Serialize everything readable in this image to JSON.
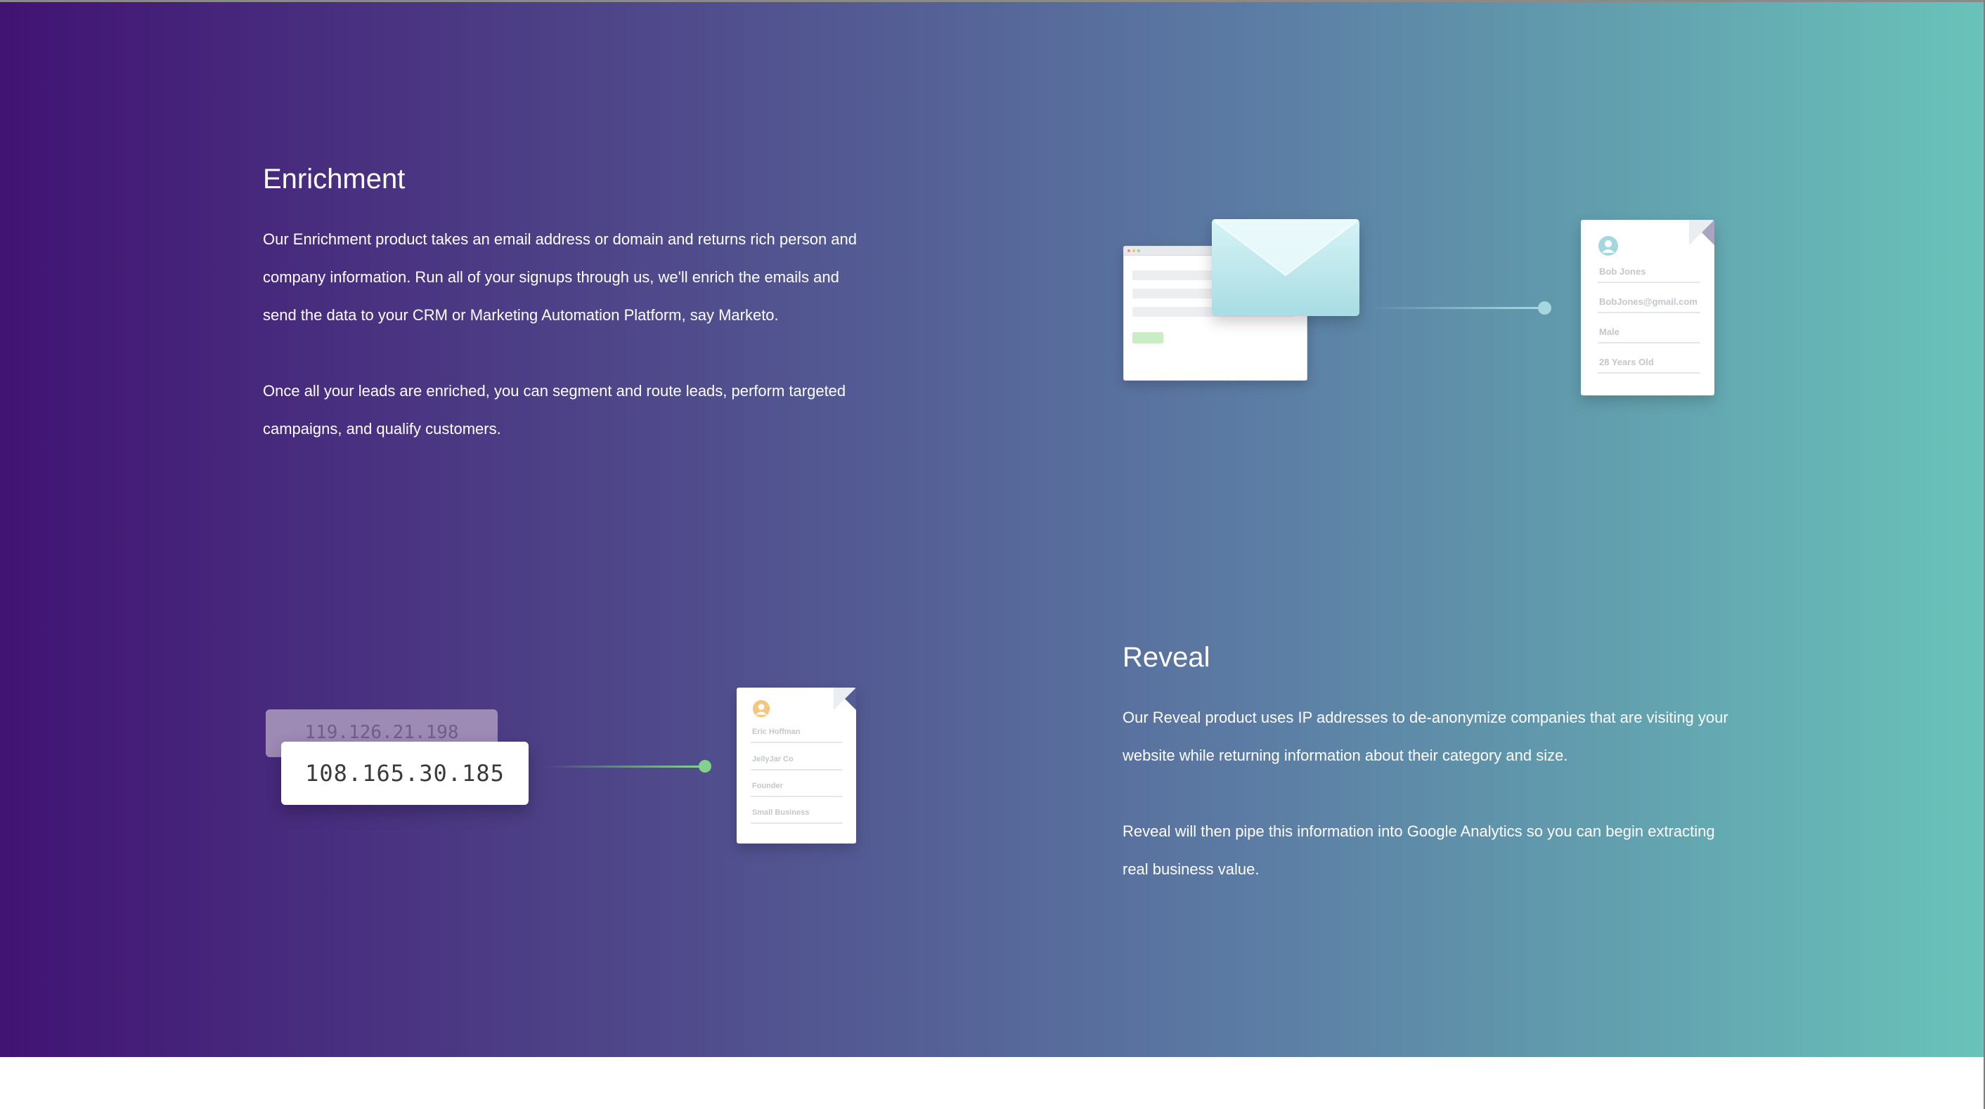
{
  "enrichment": {
    "title": "Enrichment",
    "paragraph1": "Our Enrichment product takes an email address or domain and returns rich person and company information. Run all of your signups through us, we'll enrich the emails and send the data to your CRM or Marketing Automation Platform, say Marketo.",
    "paragraph2": "Once all your leads are enriched, you can segment and route leads, perform targeted campaigns, and qualify customers.",
    "profile_card": {
      "name": "Bob Jones",
      "email": "BobJones@gmail.com",
      "gender": "Male",
      "age": "28 Years Old"
    }
  },
  "reveal": {
    "title": "Reveal",
    "paragraph1": "Our Reveal product uses IP addresses to de-anonymize companies that are visiting your website while returning information about their category and size.",
    "paragraph2": "Reveal will then pipe this information into Google Analytics so you can begin extracting real business value.",
    "ip_previous": "119.126.21.198",
    "ip_current": "108.165.30.185",
    "company_card": {
      "name": "Eric Hoffman",
      "company": "JellyJar Co",
      "role": "Founder",
      "category": "Small Business"
    }
  },
  "colors": {
    "gradient_start": "#411373",
    "gradient_end": "#69c3b9",
    "enrich_accent": "#a5d7e1",
    "reveal_accent": "#80d28c",
    "avatar_enrich": "#a5d7e1",
    "avatar_reveal": "#f3c77e"
  },
  "icons": [
    "browser-window-icon",
    "envelope-icon",
    "user-avatar-icon",
    "document-icon"
  ]
}
